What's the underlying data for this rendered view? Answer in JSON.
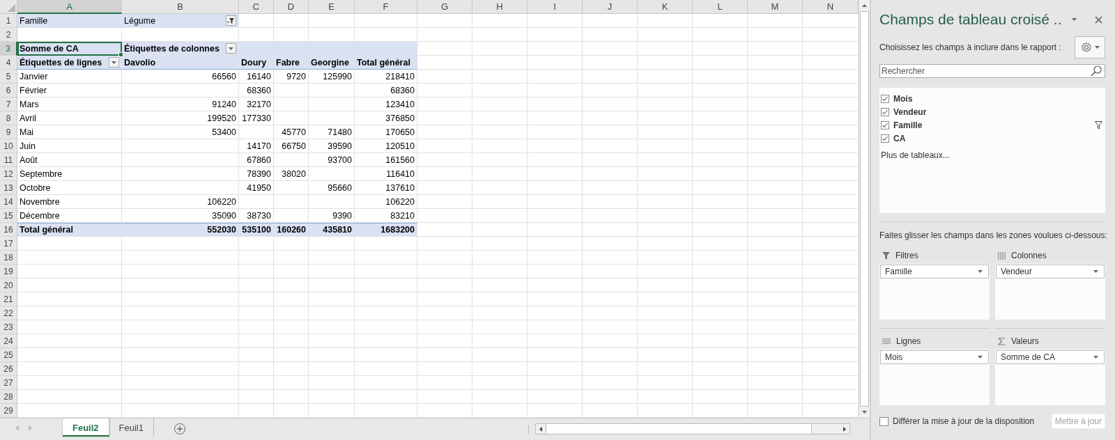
{
  "sheet": {
    "columns": [
      {
        "label": "A",
        "selected": true
      },
      {
        "label": "B",
        "selected": false
      },
      {
        "label": "C",
        "selected": false
      },
      {
        "label": "D",
        "selected": false
      },
      {
        "label": "E",
        "selected": false
      },
      {
        "label": "F",
        "selected": false
      },
      {
        "label": "G",
        "selected": false
      },
      {
        "label": "H",
        "selected": false
      },
      {
        "label": "I",
        "selected": false
      },
      {
        "label": "J",
        "selected": false
      },
      {
        "label": "K",
        "selected": false
      },
      {
        "label": "L",
        "selected": false
      },
      {
        "label": "M",
        "selected": false
      },
      {
        "label": "N",
        "selected": false
      }
    ],
    "rows": [
      {
        "number": "1",
        "selected": false,
        "kind": "filter",
        "cells": [
          "Famille",
          "Légume"
        ]
      },
      {
        "number": "2",
        "selected": false,
        "kind": "empty",
        "cells": []
      },
      {
        "number": "3",
        "selected": true,
        "kind": "pivot-header",
        "cells": [
          "Somme de CA",
          "Étiquettes de colonnes"
        ]
      },
      {
        "number": "4",
        "selected": false,
        "kind": "column-header",
        "cells": [
          "Étiquettes de lignes",
          "Davolio",
          "Doury",
          "Fabre",
          "Georgine",
          "Total général"
        ]
      },
      {
        "number": "5",
        "selected": false,
        "kind": "data",
        "cells": [
          "Janvier",
          "66560",
          "16140",
          "9720",
          "125990",
          "218410"
        ]
      },
      {
        "number": "6",
        "selected": false,
        "kind": "data",
        "cells": [
          "Février",
          null,
          "68360",
          null,
          null,
          "68360"
        ]
      },
      {
        "number": "7",
        "selected": false,
        "kind": "data",
        "cells": [
          "Mars",
          "91240",
          "32170",
          null,
          null,
          "123410"
        ]
      },
      {
        "number": "8",
        "selected": false,
        "kind": "data",
        "cells": [
          "Avril",
          "199520",
          "177330",
          null,
          null,
          "376850"
        ]
      },
      {
        "number": "9",
        "selected": false,
        "kind": "data",
        "cells": [
          "Mai",
          "53400",
          null,
          "45770",
          "71480",
          "170650"
        ]
      },
      {
        "number": "10",
        "selected": false,
        "kind": "data",
        "cells": [
          "Juin",
          null,
          "14170",
          "66750",
          "39590",
          "120510"
        ]
      },
      {
        "number": "11",
        "selected": false,
        "kind": "data",
        "cells": [
          "Août",
          null,
          "67860",
          null,
          "93700",
          "161560"
        ]
      },
      {
        "number": "12",
        "selected": false,
        "kind": "data",
        "cells": [
          "Septembre",
          null,
          "78390",
          "38020",
          null,
          "116410"
        ]
      },
      {
        "number": "13",
        "selected": false,
        "kind": "data",
        "cells": [
          "Octobre",
          null,
          "41950",
          null,
          "95660",
          "137610"
        ]
      },
      {
        "number": "14",
        "selected": false,
        "kind": "data",
        "cells": [
          "Novembre",
          "106220",
          null,
          null,
          null,
          "106220"
        ]
      },
      {
        "number": "15",
        "selected": false,
        "kind": "data",
        "cells": [
          "Décembre",
          "35090",
          "38730",
          null,
          "9390",
          "83210"
        ]
      },
      {
        "number": "16",
        "selected": false,
        "kind": "total",
        "cells": [
          "Total général",
          "552030",
          "535100",
          "160260",
          "435810",
          "1683200"
        ]
      },
      {
        "number": "17",
        "selected": false,
        "kind": "empty",
        "cells": []
      },
      {
        "number": "18",
        "selected": false,
        "kind": "empty",
        "cells": []
      },
      {
        "number": "19",
        "selected": false,
        "kind": "empty",
        "cells": []
      },
      {
        "number": "20",
        "selected": false,
        "kind": "empty",
        "cells": []
      },
      {
        "number": "21",
        "selected": false,
        "kind": "empty",
        "cells": []
      },
      {
        "number": "22",
        "selected": false,
        "kind": "empty",
        "cells": []
      },
      {
        "number": "23",
        "selected": false,
        "kind": "empty",
        "cells": []
      },
      {
        "number": "24",
        "selected": false,
        "kind": "empty",
        "cells": []
      },
      {
        "number": "25",
        "selected": false,
        "kind": "empty",
        "cells": []
      },
      {
        "number": "26",
        "selected": false,
        "kind": "empty",
        "cells": []
      },
      {
        "number": "27",
        "selected": false,
        "kind": "empty",
        "cells": []
      },
      {
        "number": "28",
        "selected": false,
        "kind": "empty",
        "cells": []
      },
      {
        "number": "29",
        "selected": false,
        "kind": "empty",
        "cells": []
      }
    ]
  },
  "sheet_tabs": [
    {
      "label": "Feuil2",
      "selected": true
    },
    {
      "label": "Feuil1",
      "selected": false
    }
  ],
  "panel": {
    "title": "Champs de tableau croisé ..",
    "subtitle": "Choisissez les champs à inclure dans le rapport :",
    "search": {
      "placeholder": "Rechercher"
    },
    "fields": [
      {
        "label": "Mois",
        "checked": true,
        "filtered": false
      },
      {
        "label": "Vendeur",
        "checked": true,
        "filtered": false
      },
      {
        "label": "Famille",
        "checked": true,
        "filtered": true
      },
      {
        "label": "CA",
        "checked": true,
        "filtered": false
      }
    ],
    "more_tables": "Plus de tableaux...",
    "drag_hint": "Faites glisser les champs dans les zones voulues ci-dessous:",
    "areas": [
      {
        "kind": "filters",
        "title": "Filtres",
        "items": [
          "Famille"
        ]
      },
      {
        "kind": "columns",
        "title": "Colonnes",
        "items": [
          "Vendeur"
        ]
      },
      {
        "kind": "rows",
        "title": "Lignes",
        "items": [
          "Mois"
        ]
      },
      {
        "kind": "values",
        "title": "Valeurs",
        "items": [
          "Somme de CA"
        ]
      }
    ],
    "defer": {
      "label": "Différer la mise à jour de la disposition",
      "checked": false
    },
    "update_button": {
      "label": "Mettre à jour",
      "disabled": true
    }
  }
}
